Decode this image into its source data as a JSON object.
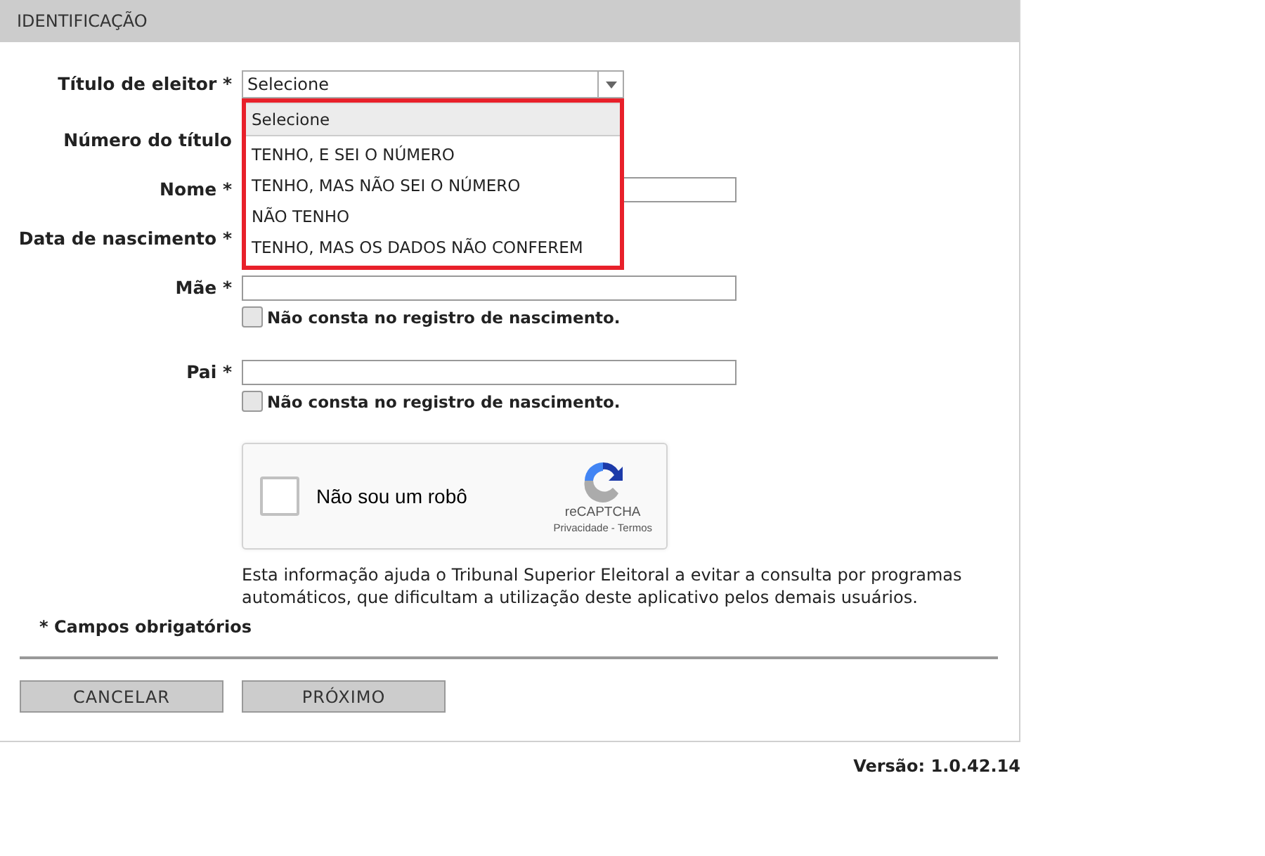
{
  "section": {
    "title": "IDENTIFICAÇÃO"
  },
  "fields": [
    {
      "kind": "select",
      "label": "Título de eleitor *",
      "value": "Selecione",
      "expanded": true,
      "options": [
        {
          "label": "Selecione",
          "selected": true
        },
        {
          "label": "TENHO, E SEI O NÚMERO",
          "selected": false
        },
        {
          "label": "TENHO, MAS NÃO SEI O NÚMERO",
          "selected": false
        },
        {
          "label": "NÃO TENHO",
          "selected": false
        },
        {
          "label": "TENHO, MAS OS DADOS NÃO CONFEREM",
          "selected": false
        }
      ]
    },
    {
      "kind": "hidden",
      "label": "Número do título"
    },
    {
      "kind": "text",
      "label": "Nome *"
    },
    {
      "kind": "hidden",
      "label": "Data de nascimento *"
    },
    {
      "kind": "text",
      "label": "Mãe *",
      "checkbox": {
        "label": "Não consta no registro de nascimento.",
        "checked": false
      }
    },
    {
      "kind": "text",
      "label": "Pai *",
      "checkbox": {
        "label": "Não consta no registro de nascimento.",
        "checked": false
      }
    }
  ],
  "captcha": {
    "label": "Não sou um robô",
    "checked": false,
    "brand": "reCAPTCHA",
    "links": [
      "Privacidade",
      "Termos"
    ],
    "separator": "-"
  },
  "info": "Esta informação ajuda o Tribunal Superior Eleitoral a evitar a consulta por programas automáticos, que dificultam a utilização deste aplicativo pelos demais usuários.",
  "required_note": "* Campos obrigatórios",
  "buttons": [
    "CANCELAR",
    "PRÓXIMO"
  ],
  "version": "Versão: 1.0.42.14"
}
